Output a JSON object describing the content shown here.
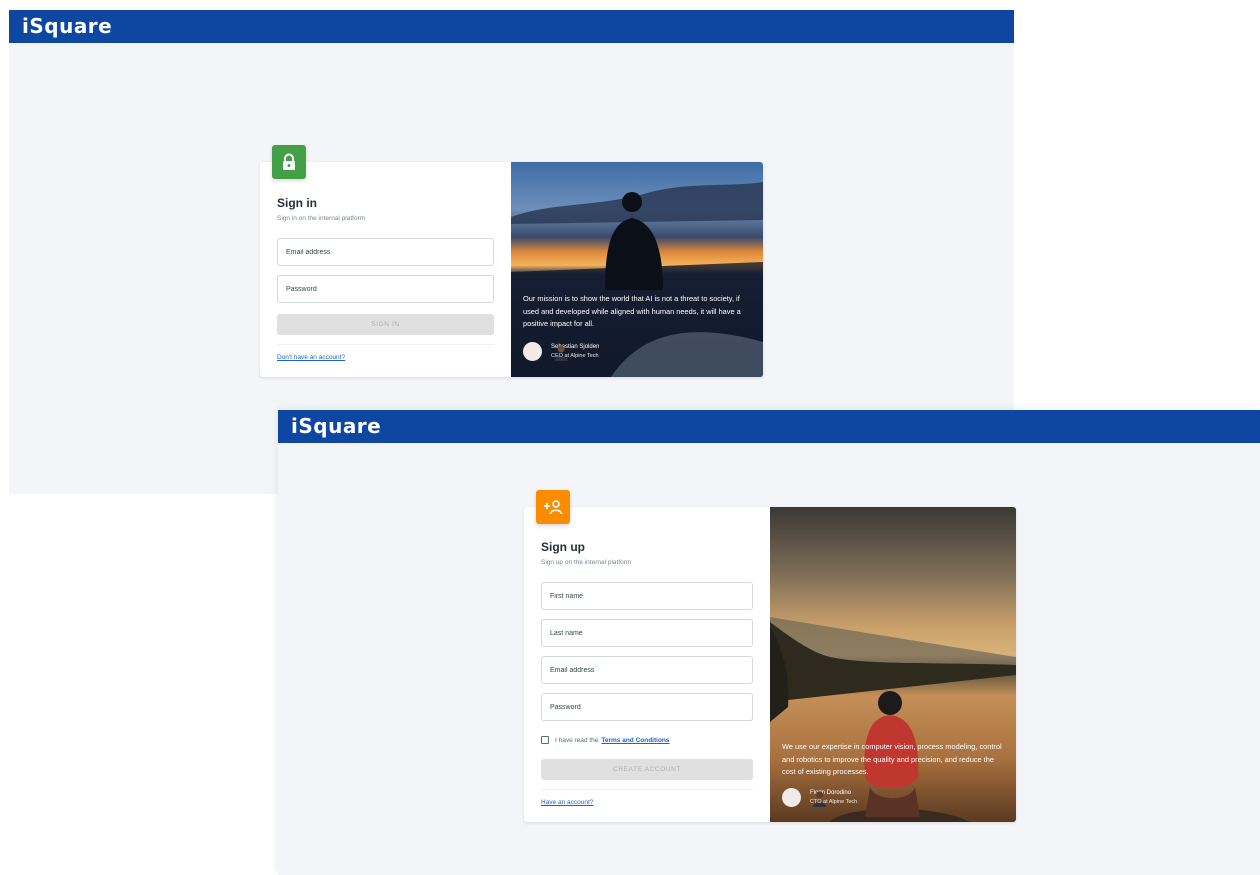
{
  "signin_screen": {
    "brand": "iSquare",
    "title": "Sign in",
    "subtitle": "Sign in on the internal platform",
    "email_placeholder": "Email address",
    "password_placeholder": "Password",
    "submit_label": "SIGN IN",
    "footer_link": "Don't have an account?",
    "quote": "Our mission is to show the world that AI is not a threat to society, if used and developed while aligned with human needs, it will have a positive impact for all.",
    "author_name": "Sebastian Sjolden",
    "author_role": "CEO at Alpine Tech",
    "badge_icon": "lock-icon",
    "badge_color": "#43a047"
  },
  "signup_screen": {
    "brand": "iSquare",
    "title": "Sign up",
    "subtitle": "Sign up on the internal platform",
    "first_name_placeholder": "First name",
    "last_name_placeholder": "Last name",
    "email_placeholder": "Email address",
    "password_placeholder": "Password",
    "terms_prefix": "I have read the",
    "terms_link": "Terms and Conditions",
    "submit_label": "CREATE ACCOUNT",
    "footer_link": "Have an account?",
    "quote": "We use our expertise in computer vision, process modeling, control and robotics to improve the quality and precision, and reduce the cost of existing processes.",
    "author_name": "Florin Dorodino",
    "author_role": "CTO at Alpine Tech",
    "badge_icon": "add-user-icon",
    "badge_color": "#fb8c00"
  },
  "colors": {
    "topbar": "#0d47a1",
    "page_background": "#f3f5f8",
    "link": "#1e63c9"
  }
}
